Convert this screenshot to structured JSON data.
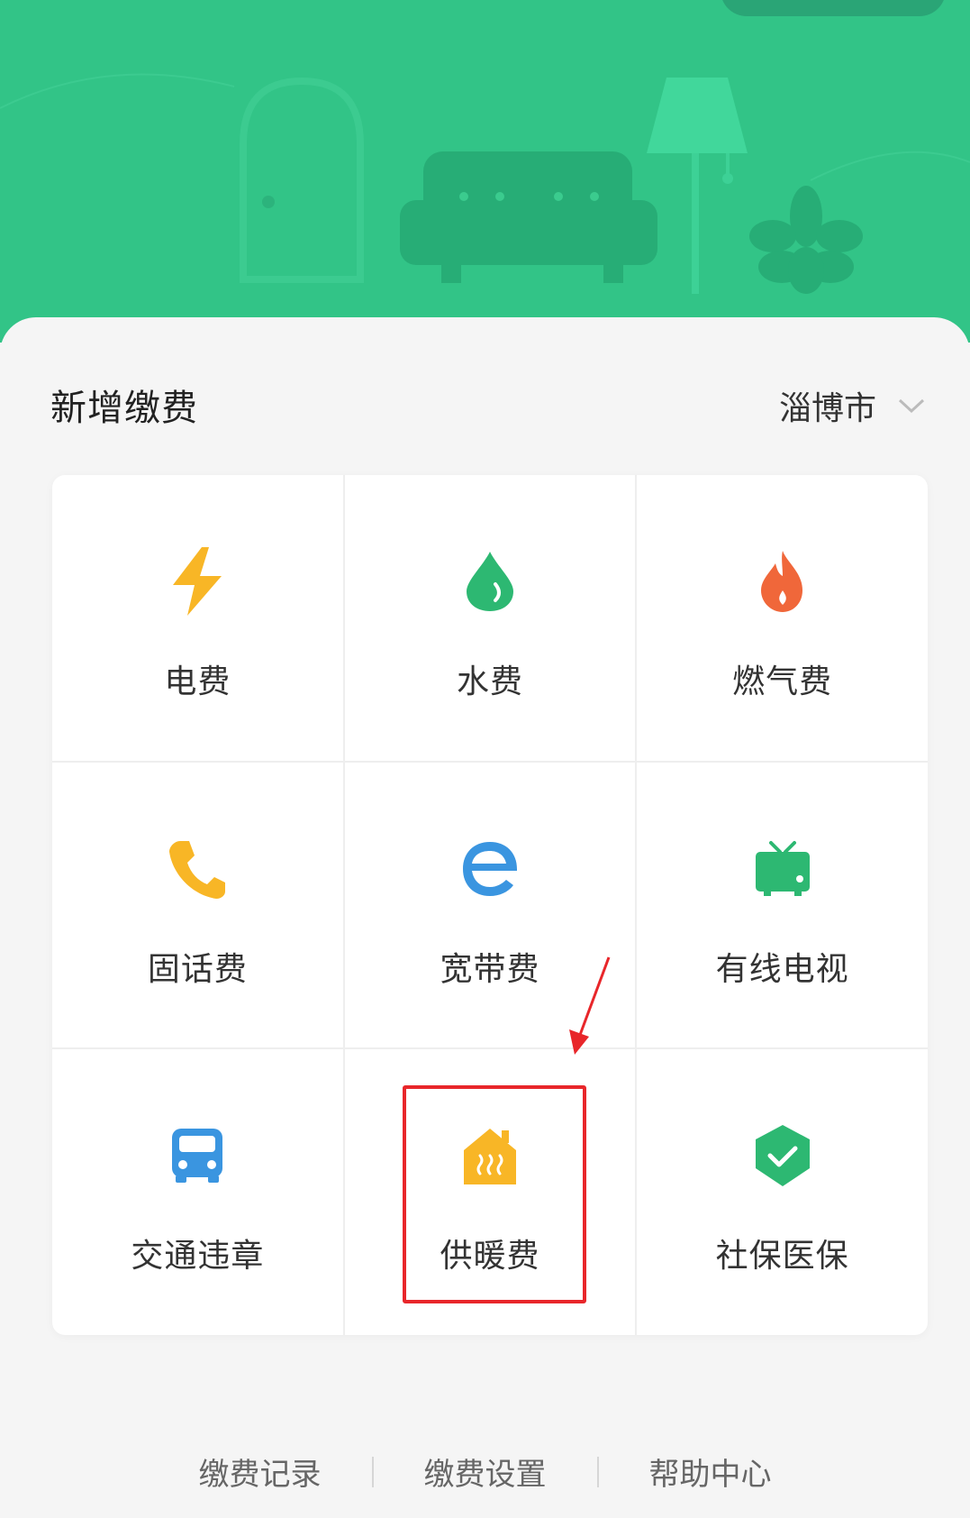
{
  "header": {
    "section_title": "新增缴费",
    "city": "淄博市"
  },
  "services": [
    {
      "label": "电费",
      "icon": "lightning-icon",
      "color": "#f8b626"
    },
    {
      "label": "水费",
      "icon": "water-drop-icon",
      "color": "#2db872"
    },
    {
      "label": "燃气费",
      "icon": "flame-icon",
      "color": "#f0673a"
    },
    {
      "label": "固话费",
      "icon": "phone-icon",
      "color": "#f8b626"
    },
    {
      "label": "宽带费",
      "icon": "broadband-e-icon",
      "color": "#3a95e0"
    },
    {
      "label": "有线电视",
      "icon": "tv-icon",
      "color": "#2db872"
    },
    {
      "label": "交通违章",
      "icon": "car-icon",
      "color": "#3a95e0"
    },
    {
      "label": "供暖费",
      "icon": "heating-house-icon",
      "color": "#f8b626"
    },
    {
      "label": "社保医保",
      "icon": "shield-check-icon",
      "color": "#2db872"
    }
  ],
  "footer": {
    "links": [
      "缴费记录",
      "缴费设置",
      "帮助中心"
    ]
  },
  "colors": {
    "brand_green": "#32c487",
    "highlight_red": "#e8262a"
  }
}
